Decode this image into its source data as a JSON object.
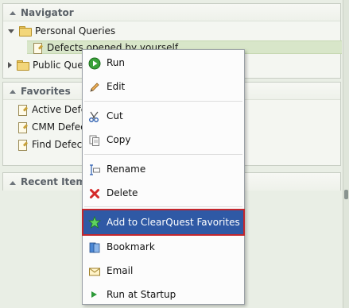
{
  "navigator": {
    "title": "Navigator",
    "personal_queries": "Personal Queries",
    "defects_query": "Defects opened by yourself",
    "public_queries": "Public Queries"
  },
  "favorites": {
    "title": "Favorites",
    "items": [
      "Active Defects",
      "CMM Defects",
      "Find Defects"
    ]
  },
  "recent": {
    "title": "Recent Items"
  },
  "context_menu": {
    "items": {
      "run": "Run",
      "edit": "Edit",
      "cut": "Cut",
      "copy": "Copy",
      "rename": "Rename",
      "delete": "Delete",
      "add_favorites": "Add to ClearQuest Favorites",
      "bookmark": "Bookmark",
      "email": "Email",
      "run_at_startup": "Run at Startup"
    },
    "highlight_color": "#2f59a5",
    "highlight_border": "#c3262d"
  },
  "icons": {
    "run": "run-icon",
    "edit": "pencil-icon",
    "cut": "scissors-icon",
    "copy": "copy-icon",
    "rename": "rename-icon",
    "delete": "delete-icon",
    "add_favorites": "star-icon",
    "bookmark": "bookmark-icon",
    "email": "email-icon",
    "run_at_startup": "play-arrow-icon"
  }
}
